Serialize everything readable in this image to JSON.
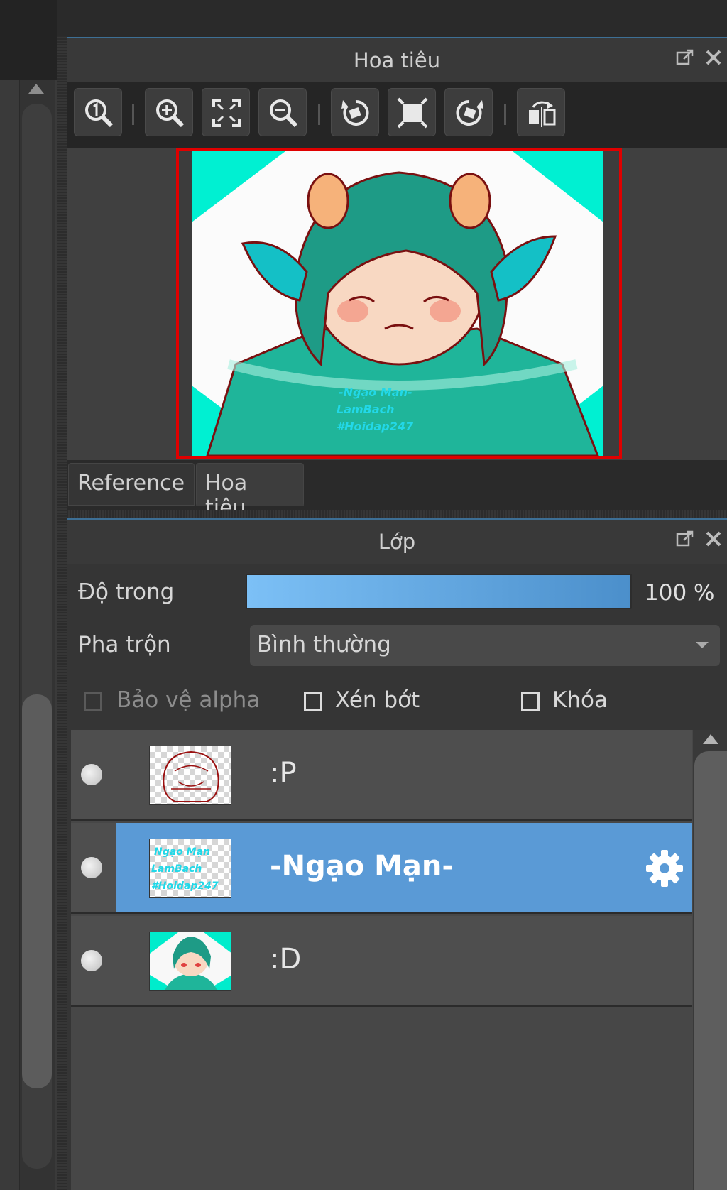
{
  "navigator": {
    "title": "Hoa tiêu",
    "tools": [
      "zoom-actual-icon",
      "zoom-in-icon",
      "fit-screen-icon",
      "zoom-out-icon",
      "rotate-left-icon",
      "fit-canvas-icon",
      "rotate-right-icon",
      "flip-horizontal-icon"
    ],
    "preview_watermark": [
      "-Ngạo Mạn-",
      "LamBach",
      "#Hoidap247"
    ]
  },
  "tabs": [
    {
      "label": "Reference",
      "active": false
    },
    {
      "label": "Hoa tiêu",
      "active": true
    }
  ],
  "layers": {
    "title": "Lớp",
    "opacity_label": "Độ trong",
    "opacity_value": "100 %",
    "opacity_fraction": 1.0,
    "blend_label": "Pha trộn",
    "blend_value": "Bình thường",
    "protect_alpha_label": "Bảo vệ alpha",
    "clip_label": "Xén bớt",
    "lock_label": "Khóa",
    "items": [
      {
        "name": ":P",
        "selected": false
      },
      {
        "name": "-Ngạo Mạn-",
        "selected": true
      },
      {
        "name": ":D",
        "selected": false
      }
    ],
    "thumb_text": [
      "Ngạo Mạn",
      "LamBach",
      "#Hoidap247"
    ]
  },
  "colors": {
    "accent": "#5a9ad6",
    "frame": "#e00000",
    "preview_bg": "#00f0d0"
  }
}
